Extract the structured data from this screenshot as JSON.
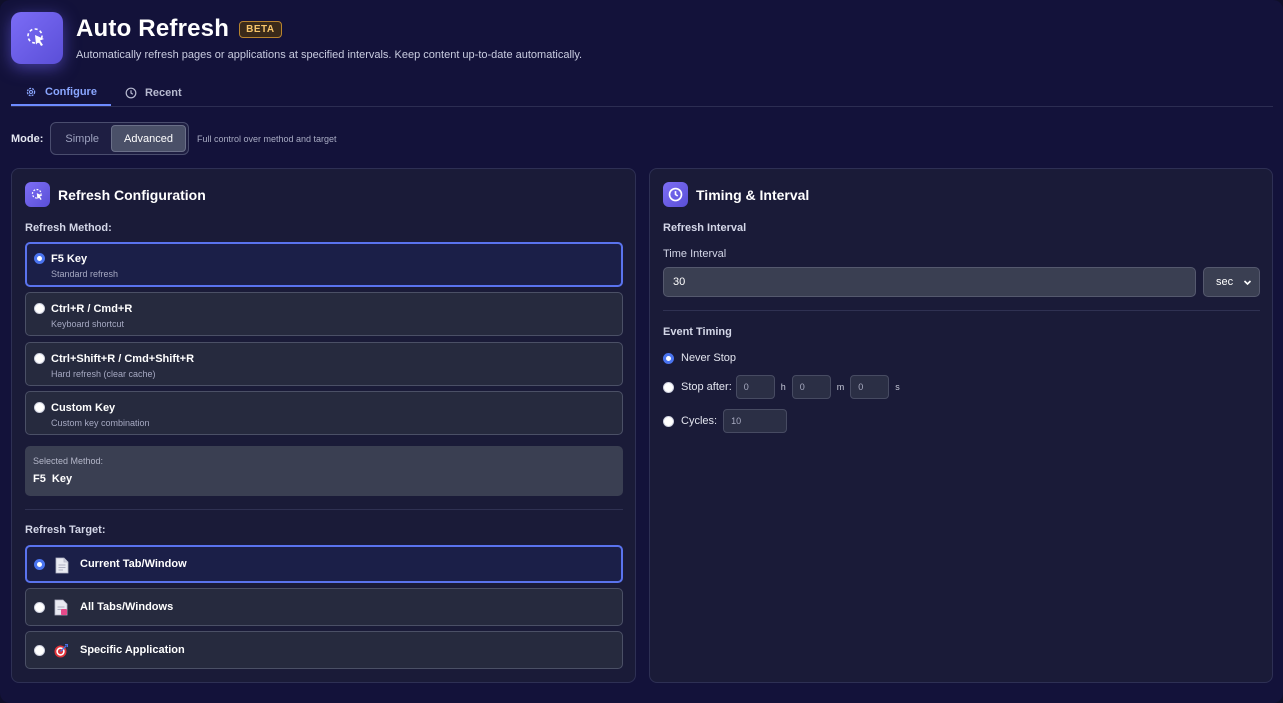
{
  "header": {
    "title": "Auto Refresh",
    "badge": "BETA",
    "subtitle": "Automatically refresh pages or applications at specified intervals. Keep content up-to-date automatically."
  },
  "tabs": [
    {
      "label": "Configure",
      "icon": "gear-icon",
      "active": true
    },
    {
      "label": "Recent",
      "icon": "clock-icon",
      "active": false
    }
  ],
  "mode": {
    "label": "Mode:",
    "options": [
      "Simple",
      "Advanced"
    ],
    "selected": "Advanced",
    "description": "Full control over method and target"
  },
  "refresh_config": {
    "title": "Refresh Configuration",
    "method_label": "Refresh Method:",
    "methods": [
      {
        "title": "F5 Key",
        "subtitle": "Standard refresh",
        "selected": true
      },
      {
        "title": "Ctrl+R / Cmd+R",
        "subtitle": "Keyboard shortcut",
        "selected": false
      },
      {
        "title": "Ctrl+Shift+R / Cmd+Shift+R",
        "subtitle": "Hard refresh (clear cache)",
        "selected": false
      },
      {
        "title": "Custom Key",
        "subtitle": "Custom key combination",
        "selected": false
      }
    ],
    "selected_method_label": "Selected Method:",
    "selected_method_value": "F5 Key",
    "target_label": "Refresh Target:",
    "targets": [
      {
        "label": "Current Tab/Window",
        "icon": "document-icon",
        "selected": true
      },
      {
        "label": "All Tabs/Windows",
        "icon": "documents-icon",
        "selected": false
      },
      {
        "label": "Specific Application",
        "icon": "target-icon",
        "selected": false
      }
    ]
  },
  "timing": {
    "title": "Timing & Interval",
    "interval_section": "Refresh Interval",
    "time_interval_label": "Time Interval",
    "interval_value": "30",
    "unit_value": "sec",
    "event_section": "Event Timing",
    "never_stop_label": "Never Stop",
    "stop_after_label": "Stop after:",
    "stop_h": "0",
    "stop_m": "0",
    "stop_s": "0",
    "unit_h": "h",
    "unit_m": "m",
    "unit_s": "s",
    "cycles_label": "Cycles:",
    "cycles_value": "10",
    "selected_event": "Never Stop"
  },
  "colors": {
    "accent": "#6d8bff",
    "brand": "#6b5ef0",
    "badge": "#f7c56b"
  }
}
